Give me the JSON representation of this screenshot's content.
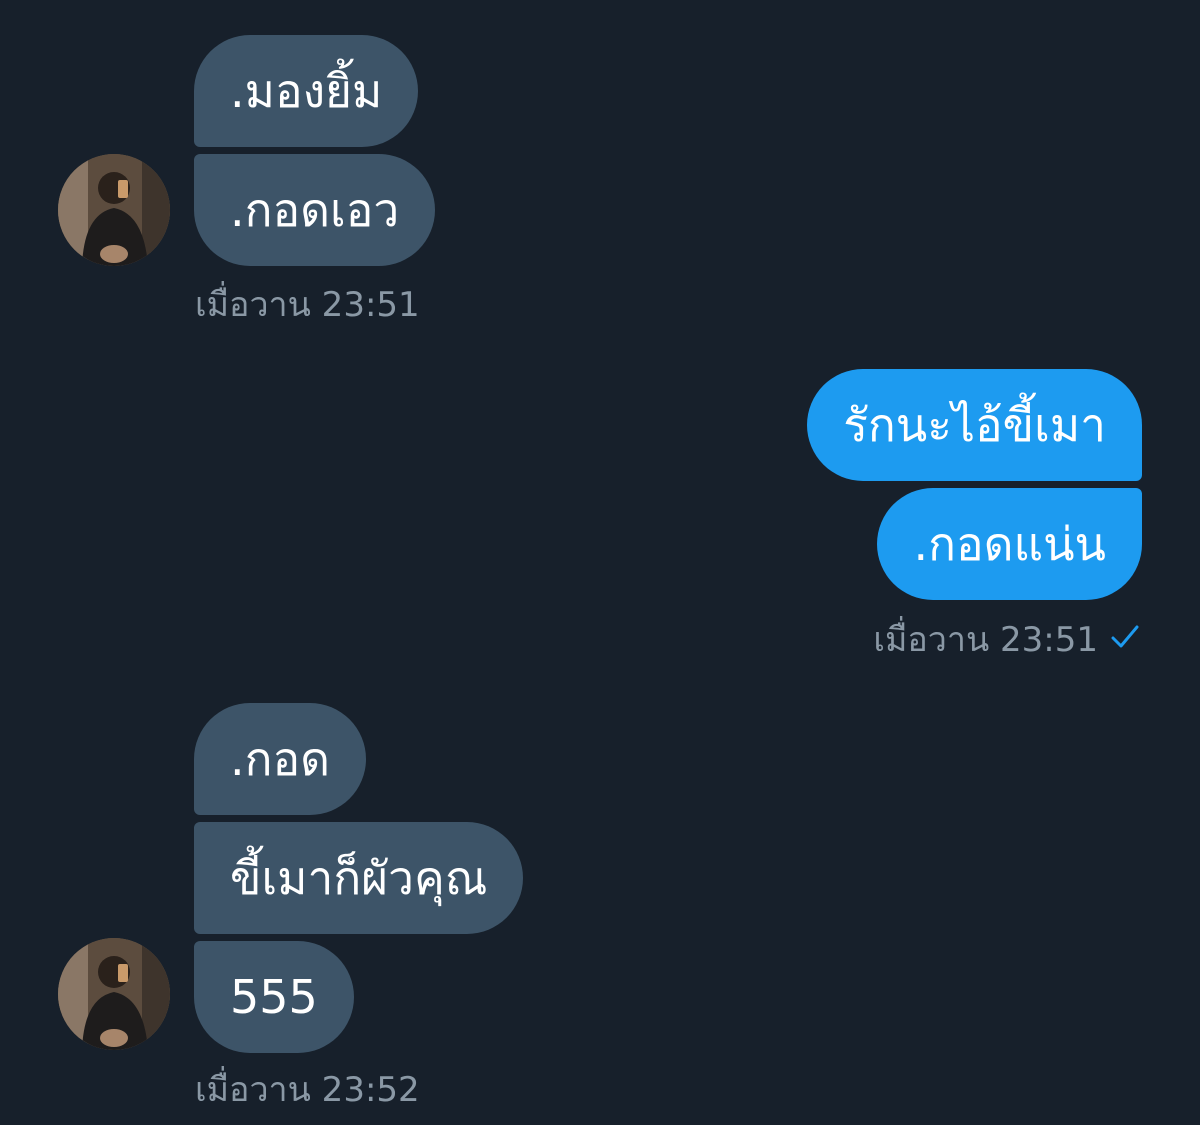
{
  "groups": [
    {
      "direction": "incoming",
      "messages": [
        ".มองยิ้ม",
        ".กอดเอว"
      ],
      "timestamp": "เมื่อวาน 23:51"
    },
    {
      "direction": "outgoing",
      "messages": [
        "รักนะไอ้ขี้เมา",
        ".กอดแน่น"
      ],
      "timestamp": "เมื่อวาน 23:51",
      "status_icon": "checkmark-icon"
    },
    {
      "direction": "incoming",
      "messages": [
        ".กอด",
        "ขี้เมาก็ผัวคุณ",
        "555"
      ],
      "timestamp": "เมื่อวาน 23:52"
    }
  ],
  "colors": {
    "background": "#17202b",
    "incoming_bubble": "#3d5468",
    "outgoing_bubble": "#1d9bf0",
    "timestamp": "#8a98a5",
    "sent_check": "#1d9bf0"
  }
}
